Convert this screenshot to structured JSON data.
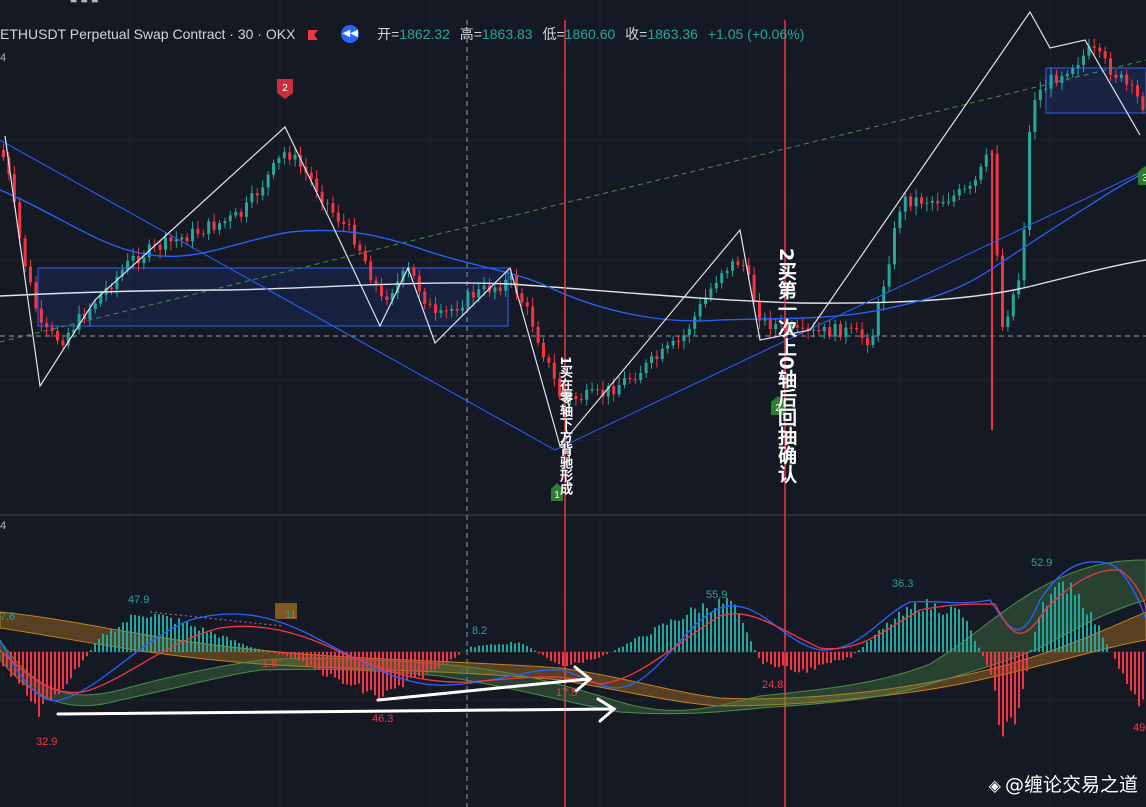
{
  "header": {
    "symbol": "ETHUSDT Perpetual Swap Contract · 30 · OKX",
    "flag_color": "#f23645",
    "open_label": "开=",
    "open_value": "1862.32",
    "high_label": "高=",
    "high_value": "1863.83",
    "low_label": "低=",
    "low_value": "1860.60",
    "close_label": "收=",
    "close_value": "1863.36",
    "change": "+1.05 (+0.06%)"
  },
  "annotations": {
    "vertical_text_1": "1买在零轴下方背驰形成",
    "vertical_text_2": "2买第一次上0轴后回抽确认",
    "marker_2_top": "2",
    "marker_1_bottom": "1",
    "marker_2_bottom": "2",
    "marker_3_right": "3"
  },
  "macd_labels": {
    "l_7_6": "7.6",
    "l_47_9": "47.9",
    "l_11": "11",
    "l_1_8": "1.8",
    "l_8_2": "8.2",
    "l_46_3": "46.3",
    "l_32_9": "32.9",
    "l_17_5": "17.5",
    "l_55_9": "55.9",
    "l_24_8": "24.8",
    "l_36_3": "36.3",
    "l_52_9": "52.9",
    "l_49": "49",
    "l_4": "4"
  },
  "watermark": "@缠论交易之道",
  "colors": {
    "background": "#151924",
    "up": "#26a69a",
    "down": "#f23645",
    "zone": "#2962ff",
    "ma_blue": "#2962ff",
    "ma_white": "#e0e3eb",
    "red_vline": "#f23645"
  },
  "chart_data": {
    "type": "candlestick",
    "symbol": "ETHUSDT",
    "timeframe": "30",
    "ohlc_last": {
      "open": 1862.32,
      "high": 1863.83,
      "low": 1860.6,
      "close": 1863.36
    },
    "indicators": [
      "moving averages",
      "zigzag strokes",
      "pivot zones",
      "MACD"
    ],
    "macd_peak_labels": [
      7.6,
      47.9,
      11,
      1.8,
      8.2,
      46.3,
      32.9,
      17.5,
      55.9,
      24.8,
      36.3,
      52.9,
      49
    ]
  }
}
